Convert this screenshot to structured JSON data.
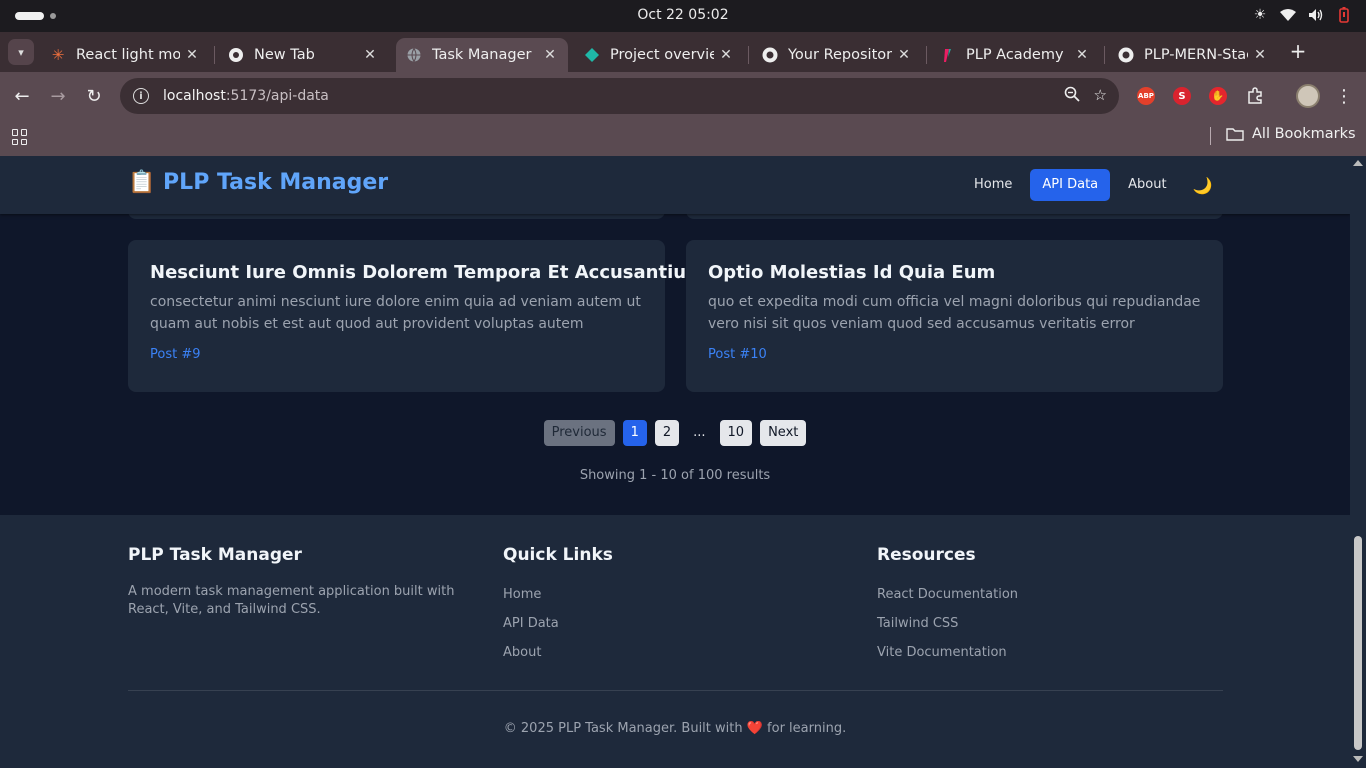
{
  "system": {
    "clock": "Oct 22  05:02"
  },
  "browser": {
    "tabs": [
      {
        "title": "React light mode",
        "favicon": "react-asterisk-icon",
        "active": false
      },
      {
        "title": "New Tab",
        "favicon": "chrome-icon",
        "active": false
      },
      {
        "title": "Task Manager",
        "favicon": "globe-icon",
        "active": true
      },
      {
        "title": "Project overview",
        "favicon": "diamond-icon",
        "active": false
      },
      {
        "title": "Your Repositories",
        "favicon": "github-icon",
        "active": false
      },
      {
        "title": "PLP Academy",
        "favicon": "plp-icon",
        "active": false
      },
      {
        "title": "PLP-MERN-Stack",
        "favicon": "github-icon",
        "active": false
      }
    ],
    "url_host": "localhost",
    "url_path": ":5173/api-data",
    "extensions": [
      {
        "name": "ABP",
        "color": "#e3402b"
      },
      {
        "name": "S",
        "color": "#d9232e"
      },
      {
        "name": "hand",
        "color": "#e4262d"
      }
    ],
    "bookmarks_label": "All Bookmarks"
  },
  "app": {
    "brand": "📋 PLP Task Manager",
    "nav": [
      {
        "label": "Home",
        "active": false
      },
      {
        "label": "API Data",
        "active": true
      },
      {
        "label": "About",
        "active": false
      }
    ],
    "theme_icon": "🌙"
  },
  "posts": [
    {
      "title": "Nesciunt Iure Omnis Dolorem Tempora Et Accusantium",
      "body": "consectetur animi nesciunt iure dolore enim quia ad veniam autem ut quam aut nobis et est aut quod aut provident voluptas autem voluptas",
      "id_label": "Post #9"
    },
    {
      "title": "Optio Molestias Id Quia Eum",
      "body": "quo et expedita modi cum officia vel magni doloribus qui repudiandae vero nisi sit quos veniam quod sed accusamus veritatis error",
      "id_label": "Post #10"
    }
  ],
  "pagination": {
    "previous": "Previous",
    "pages": [
      "1",
      "2",
      "...",
      "10"
    ],
    "current": "1",
    "next": "Next",
    "summary": "Showing 1 - 10 of 100 results"
  },
  "footer": {
    "about_title": "PLP Task Manager",
    "about_text": "A modern task management application built with React, Vite, and Tailwind CSS.",
    "quick_title": "Quick Links",
    "quick_links": [
      "Home",
      "API Data",
      "About"
    ],
    "resources_title": "Resources",
    "resources": [
      "React Documentation",
      "Tailwind CSS",
      "Vite Documentation"
    ],
    "copyright": "© 2025 PLP Task Manager. Built with ❤️ for learning."
  }
}
